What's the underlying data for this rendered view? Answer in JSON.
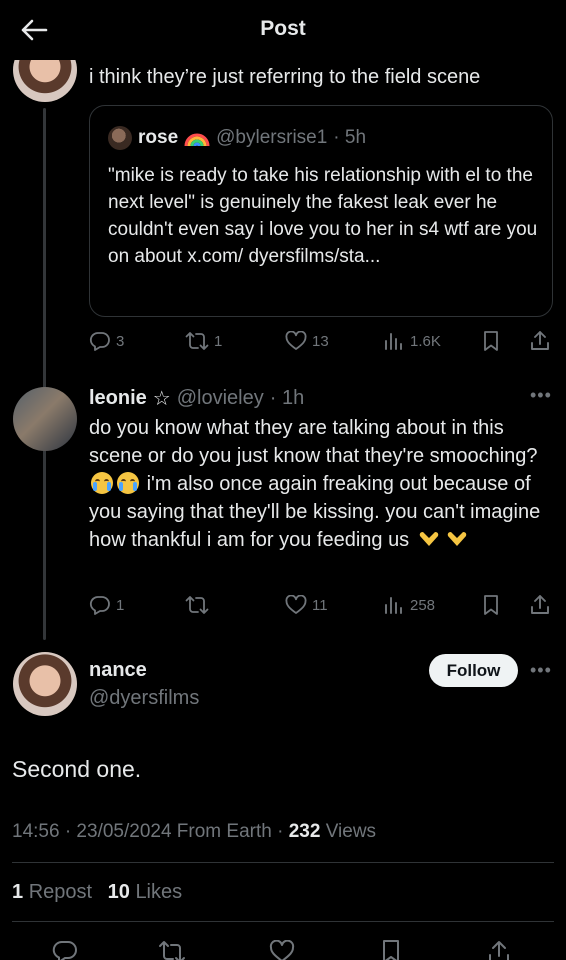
{
  "header": {
    "title": "Post"
  },
  "reply1": {
    "text": "i think they’re just referring to the field scene",
    "quote": {
      "name": "rose",
      "handle": "@bylersrise1",
      "time": "· 5h",
      "text": "\"mike is ready to take his relationship with el to the next level\" is genuinely the fakest leak ever he couldn't even say i love you to her in s4 wtf are you on about x.com/ dyersfilms/sta..."
    },
    "actions": {
      "replies": "3",
      "reposts": "1",
      "likes": "13",
      "views": "1.6K"
    }
  },
  "reply2": {
    "name": "leonie",
    "star": "☆",
    "handle": "@lovieley",
    "time": "· 1h",
    "text_a": "do you know what they are talking about in this scene or do you just know that they're smooching?",
    "text_b": "i'm also once again freaking out because of you saying that they'll be kissing. you can't imagine how thankful i am for you feeding us",
    "actions": {
      "replies": "1",
      "reposts": "",
      "likes": "11",
      "views": "258"
    }
  },
  "main_post": {
    "name": "nance",
    "handle": "@dyersfilms",
    "follow_label": "Follow",
    "text": "Second one.",
    "meta_time": "14:56 · 23/05/2024 From Earth ·",
    "views_count": "232",
    "views_label": "Views",
    "reposts_count": "1",
    "reposts_label": "Repost",
    "likes_count": "10",
    "likes_label": "Likes"
  },
  "colors": {
    "background": "#000000",
    "text": "#e7e9ea",
    "muted": "#71767b",
    "border": "#2f3336"
  },
  "icons": [
    "back-arrow-icon",
    "reply-icon",
    "repost-icon",
    "like-icon",
    "views-icon",
    "bookmark-icon",
    "share-icon",
    "more-icon"
  ]
}
